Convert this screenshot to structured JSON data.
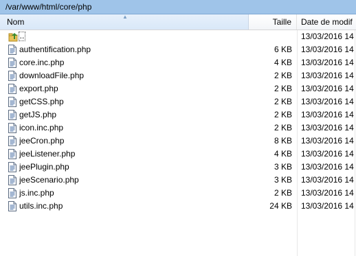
{
  "path": "/var/www/html/core/php",
  "columns": {
    "name": "Nom",
    "size": "Taille",
    "date": "Date de modif"
  },
  "parent": {
    "label": "..",
    "date": "13/03/2016 14"
  },
  "files": [
    {
      "name": "authentification.php",
      "size": "6 KB",
      "date": "13/03/2016 14"
    },
    {
      "name": "core.inc.php",
      "size": "4 KB",
      "date": "13/03/2016 14"
    },
    {
      "name": "downloadFile.php",
      "size": "2 KB",
      "date": "13/03/2016 14"
    },
    {
      "name": "export.php",
      "size": "2 KB",
      "date": "13/03/2016 14"
    },
    {
      "name": "getCSS.php",
      "size": "2 KB",
      "date": "13/03/2016 14"
    },
    {
      "name": "getJS.php",
      "size": "2 KB",
      "date": "13/03/2016 14"
    },
    {
      "name": "icon.inc.php",
      "size": "2 KB",
      "date": "13/03/2016 14"
    },
    {
      "name": "jeeCron.php",
      "size": "8 KB",
      "date": "13/03/2016 14"
    },
    {
      "name": "jeeListener.php",
      "size": "4 KB",
      "date": "13/03/2016 14"
    },
    {
      "name": "jeePlugin.php",
      "size": "3 KB",
      "date": "13/03/2016 14"
    },
    {
      "name": "jeeScenario.php",
      "size": "3 KB",
      "date": "13/03/2016 14"
    },
    {
      "name": "js.inc.php",
      "size": "2 KB",
      "date": "13/03/2016 14"
    },
    {
      "name": "utils.inc.php",
      "size": "24 KB",
      "date": "13/03/2016 14"
    }
  ],
  "icons": {
    "file": "php-file-icon",
    "parent": "parent-folder-icon"
  },
  "colors": {
    "path_bar": "#9fc4e9",
    "header_active": "#d9e8f8"
  }
}
